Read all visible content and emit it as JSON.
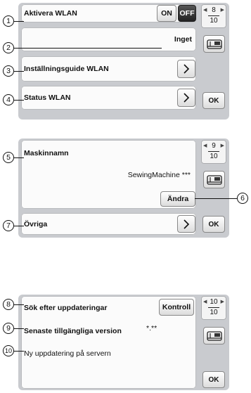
{
  "panel1": {
    "callouts": [
      "1",
      "2",
      "3",
      "4"
    ],
    "wlan_label": "Aktivera WLAN",
    "on_label": "ON",
    "off_label": "OFF",
    "network_value": "Inget",
    "guide_label": "Inställningsguide WLAN",
    "status_label": "Status WLAN",
    "page_current": "8",
    "page_total": "10",
    "ok_label": "OK"
  },
  "panel2": {
    "callouts": [
      "5",
      "6",
      "7"
    ],
    "machine_name_label": "Maskinnamn",
    "machine_name_value": "SewingMachine ***",
    "change_label": "Ändra",
    "other_label": "Övriga",
    "page_current": "9",
    "page_total": "10",
    "ok_label": "OK"
  },
  "panel3": {
    "callouts": [
      "8",
      "9",
      "10"
    ],
    "search_label": "Sök efter uppdateringar",
    "check_label": "Kontroll",
    "latest_label": "Senaste tillgängliga version",
    "latest_value": "*.**",
    "new_update_label": "Ny uppdatering på servern",
    "page_current": "10",
    "page_total": "10",
    "ok_label": "OK"
  },
  "icons": {
    "arrow": "chevron-right-icon",
    "machine": "sewing-machine-icon",
    "pager_left": "triangle-left-icon",
    "pager_right": "triangle-right-icon"
  },
  "colors": {
    "panel_bg": "#c9cbcf",
    "row_bg": "#fbfbfb",
    "toggle_on": "#2b2b2b"
  }
}
